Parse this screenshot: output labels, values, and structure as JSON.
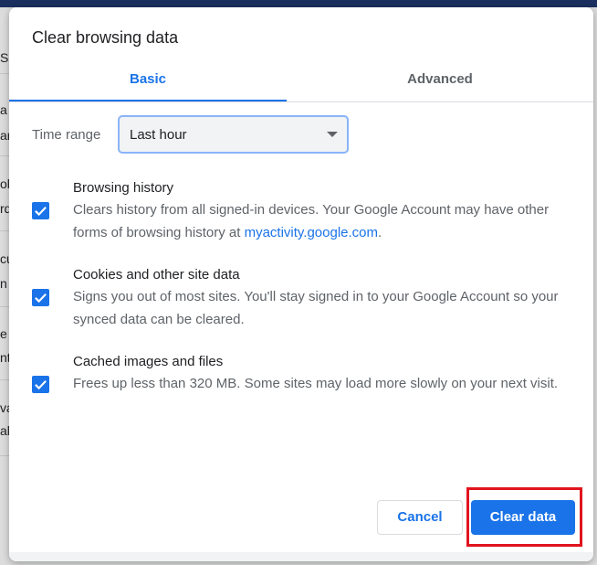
{
  "background": {
    "fragments": [
      "S",
      "a",
      "ar",
      "ok",
      "rd",
      "cu",
      "n",
      "e S",
      "nt",
      "va",
      "al"
    ]
  },
  "dialog": {
    "title": "Clear browsing data",
    "tabs": [
      {
        "label": "Basic",
        "active": true
      },
      {
        "label": "Advanced",
        "active": false
      }
    ],
    "time_range": {
      "label": "Time range",
      "value": "Last hour"
    },
    "options": [
      {
        "title": "Browsing history",
        "checked": true,
        "desc_before_link": "Clears history from all signed-in devices. Your Google Account may have other forms of browsing history at ",
        "link": "myactivity.google.com",
        "desc_after_link": "."
      },
      {
        "title": "Cookies and other site data",
        "checked": true,
        "desc": "Signs you out of most sites. You'll stay signed in to your Google Account so your synced data can be cleared."
      },
      {
        "title": "Cached images and files",
        "checked": true,
        "desc": "Frees up less than 320 MB. Some sites may load more slowly on your next visit."
      }
    ],
    "buttons": {
      "cancel": "Cancel",
      "clear": "Clear data"
    }
  },
  "colors": {
    "accent": "#1a73e8",
    "highlight": "#e0141e"
  }
}
